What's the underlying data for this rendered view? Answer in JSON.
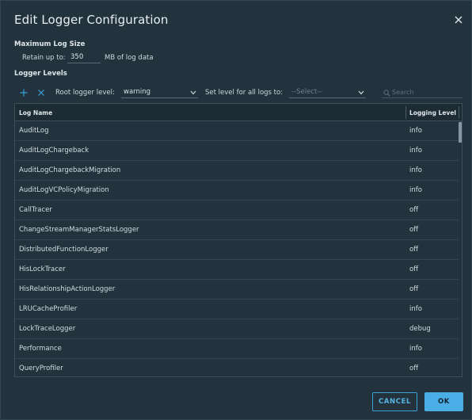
{
  "dialog": {
    "title": "Edit Logger Configuration"
  },
  "max_log_size": {
    "heading": "Maximum Log Size",
    "retain_label": "Retain up to:",
    "retain_value": "350",
    "retain_suffix": "MB of log data"
  },
  "logger_levels": {
    "heading": "Logger Levels",
    "root_label": "Root logger level:",
    "root_value": "warning",
    "set_all_label": "Set level for all logs to:",
    "set_all_placeholder": "--Select--",
    "search_placeholder": "Search"
  },
  "grid": {
    "columns": [
      "Log Name",
      "Logging Level"
    ],
    "rows": [
      {
        "name": "AuditLog",
        "level": "info"
      },
      {
        "name": "AuditLogChargeback",
        "level": "info"
      },
      {
        "name": "AuditLogChargebackMigration",
        "level": "info"
      },
      {
        "name": "AuditLogVCPolicyMigration",
        "level": "info"
      },
      {
        "name": "CallTracer",
        "level": "off"
      },
      {
        "name": "ChangeStreamManagerStatsLogger",
        "level": "off"
      },
      {
        "name": "DistributedFunctionLogger",
        "level": "off"
      },
      {
        "name": "HisLockTracer",
        "level": "off"
      },
      {
        "name": "HisRelationshipActionLogger",
        "level": "off"
      },
      {
        "name": "LRUCacheProfiler",
        "level": "info"
      },
      {
        "name": "LockTraceLogger",
        "level": "debug"
      },
      {
        "name": "Performance",
        "level": "info"
      },
      {
        "name": "QueryProfiler",
        "level": "off"
      }
    ]
  },
  "buttons": {
    "cancel": "CANCEL",
    "ok": "OK"
  },
  "icons": {
    "close": "close-icon",
    "add": "plus-icon",
    "remove": "x-icon",
    "search": "search-icon",
    "chevron": "chevron-down-icon"
  },
  "colors": {
    "background": "#22333d",
    "accent": "#49aee5",
    "text": "#d3dce1"
  }
}
